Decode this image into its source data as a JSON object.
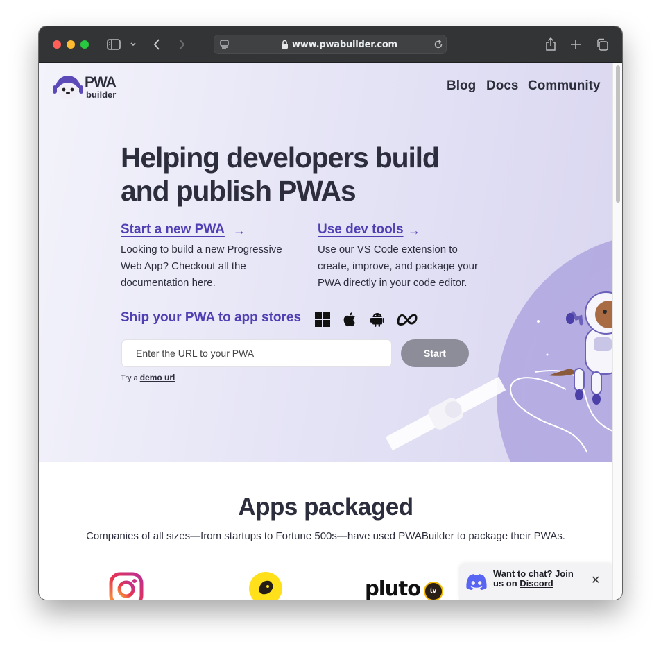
{
  "browser": {
    "url": "www.pwabuilder.com"
  },
  "site": {
    "logo_line1": "PWA",
    "logo_line2": "builder",
    "nav": [
      "Blog",
      "Docs",
      "Community"
    ]
  },
  "hero": {
    "headline": "Helping developers build and publish PWAs",
    "cards": [
      {
        "title": "Start a new PWA",
        "description": "Looking to build a new Progressive Web App? Checkout all the documentation here."
      },
      {
        "title": "Use dev tools",
        "description": "Use our VS Code extension to create, improve, and package your PWA directly in your code editor."
      }
    ],
    "arrow": "→",
    "ship_label": "Ship your PWA to app stores",
    "store_icons": [
      "windows-icon",
      "apple-icon",
      "android-icon",
      "meta-icon"
    ],
    "url_placeholder": "Enter the URL to your PWA",
    "start_label": "Start",
    "try_prefix": "Try a",
    "demo_label": "demo url"
  },
  "apps": {
    "title": "Apps packaged",
    "subtitle": "Companies of all sizes—from startups to Fortune 500s—have used PWABuilder to package their PWAs.",
    "logos": [
      "instagram-logo",
      "mailchimp-logo",
      "pluto-tv-logo"
    ],
    "pluto_text": "pluto",
    "pluto_badge": "tv"
  },
  "discord_popup": {
    "text": "Want to chat? Join us on",
    "link": "Discord",
    "close": "✕"
  },
  "colors": {
    "accent": "#4f3fb3",
    "heading": "#2c2d3d",
    "toolbar": "#323436"
  }
}
